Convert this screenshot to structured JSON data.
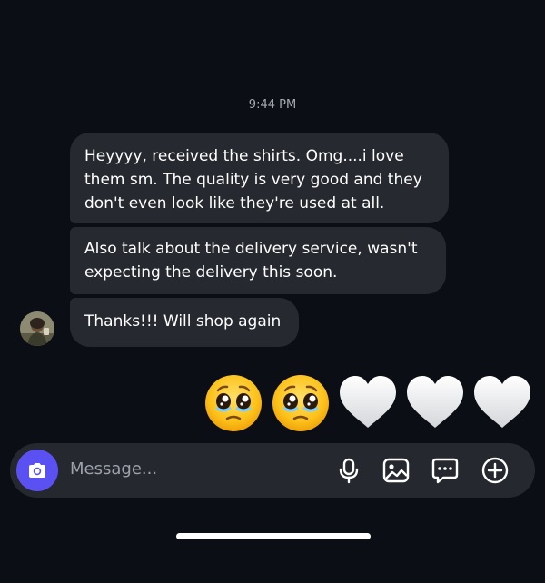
{
  "conversation": {
    "timestamp": "9:44 PM",
    "messages": [
      {
        "text": "Heyyyy, received the shirts. Omg....i love them sm. The quality is very good and they don't even look like they're used at all."
      },
      {
        "text": "Also talk about the delivery service, wasn't expecting the delivery this soon."
      },
      {
        "text": "Thanks!!! Will shop again"
      }
    ],
    "reactions": [
      "pleading-face",
      "pleading-face",
      "white-heart",
      "white-heart",
      "white-heart"
    ]
  },
  "composer": {
    "placeholder": "Message...",
    "icons": [
      "camera-icon",
      "microphone-icon",
      "gallery-icon",
      "sticker-icon",
      "add-icon"
    ],
    "accent_color": "#5b51f3"
  },
  "theme": {
    "background": "#0b0e15",
    "bubble": "#26292f"
  }
}
